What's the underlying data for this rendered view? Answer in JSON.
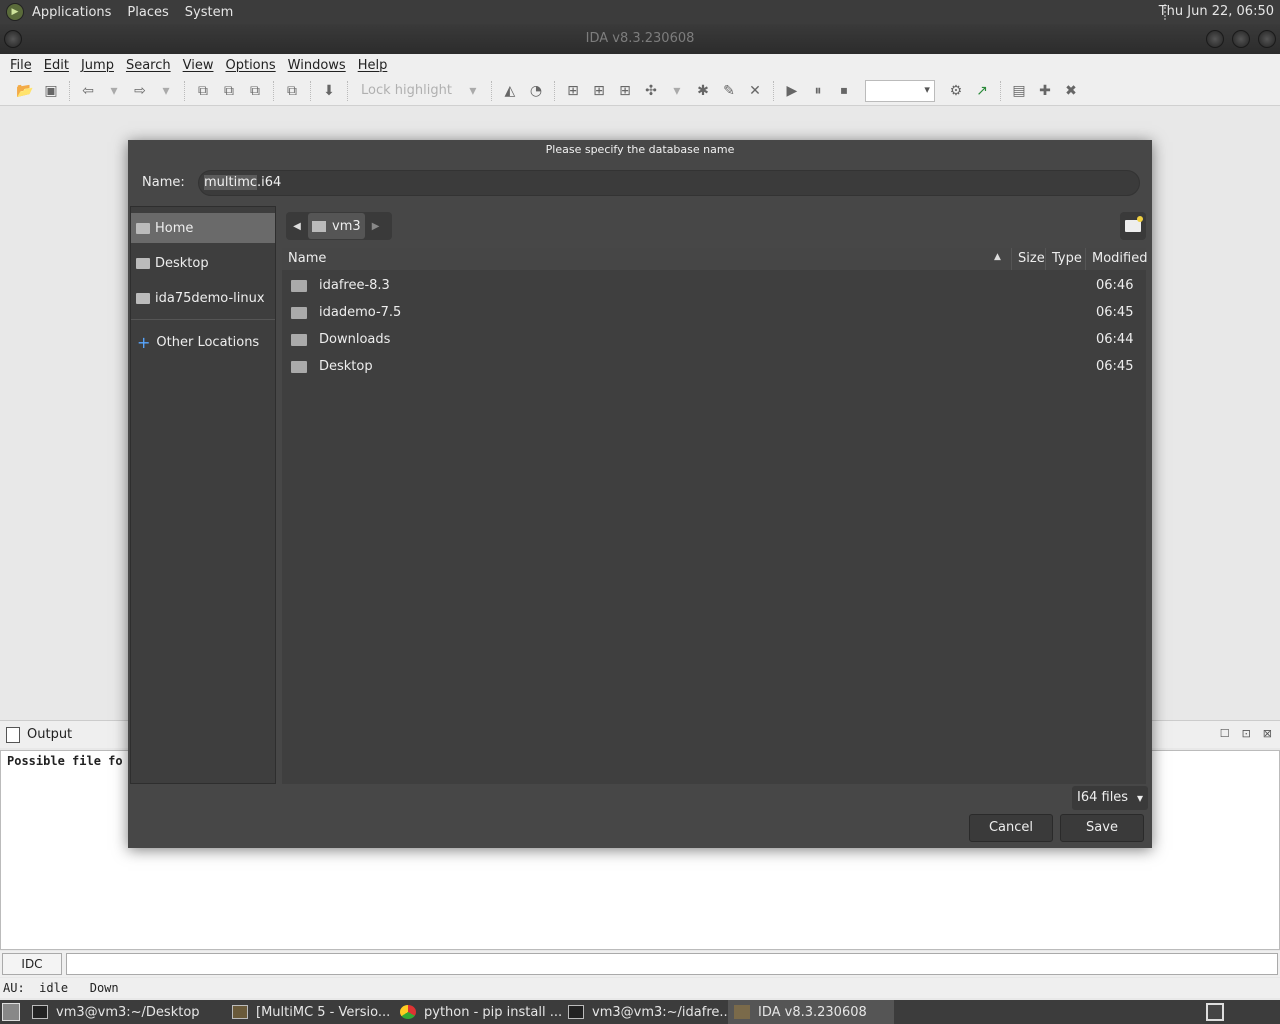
{
  "top_panel": {
    "menus": [
      "Applications",
      "Places",
      "System"
    ],
    "clock": "Thu Jun 22, 06:50"
  },
  "window": {
    "title": "IDA v8.3.230608"
  },
  "menubar": [
    "File",
    "Edit",
    "Jump",
    "Search",
    "View",
    "Options",
    "Windows",
    "Help"
  ],
  "toolbar": {
    "lock_highlight": "Lock highlight"
  },
  "dialog": {
    "title": "Please specify the database name",
    "name_label": "Name:",
    "name_selected": "multimc",
    "name_rest": ".i64",
    "places": [
      {
        "label": "Home",
        "icon": "home-folder-icon",
        "selected": true
      },
      {
        "label": "Desktop",
        "icon": "desktop-folder-icon"
      },
      {
        "label": "ida75demo-linux",
        "icon": "folder-icon"
      },
      {
        "label": "Other Locations",
        "icon": "plus-icon"
      }
    ],
    "path": {
      "current": "vm3"
    },
    "columns": {
      "name": "Name",
      "size": "Size",
      "type": "Type",
      "modified": "Modified"
    },
    "files": [
      {
        "name": "idafree-8.3",
        "modified": "06:46"
      },
      {
        "name": "idademo-7.5",
        "modified": "06:45"
      },
      {
        "name": "Downloads",
        "modified": "06:44"
      },
      {
        "name": "Desktop",
        "modified": "06:45"
      }
    ],
    "filter": "I64 files",
    "cancel_label": "Cancel",
    "save_label": "Save"
  },
  "output": {
    "title": "Output",
    "text": "Possible file fo",
    "idc_label": "IDC"
  },
  "status": {
    "au": "AU:",
    "state": "idle",
    "direction": "Down"
  },
  "taskbar": [
    {
      "label": "vm3@vm3:~/Desktop",
      "icon": "terminal-icon"
    },
    {
      "label": "[MultiMC 5 - Versio...",
      "icon": "multimc-icon"
    },
    {
      "label": "python - pip install ...",
      "icon": "chrome-icon"
    },
    {
      "label": "vm3@vm3:~/idafre...",
      "icon": "terminal-icon"
    },
    {
      "label": "IDA v8.3.230608",
      "icon": "ida-icon",
      "active": true
    }
  ]
}
